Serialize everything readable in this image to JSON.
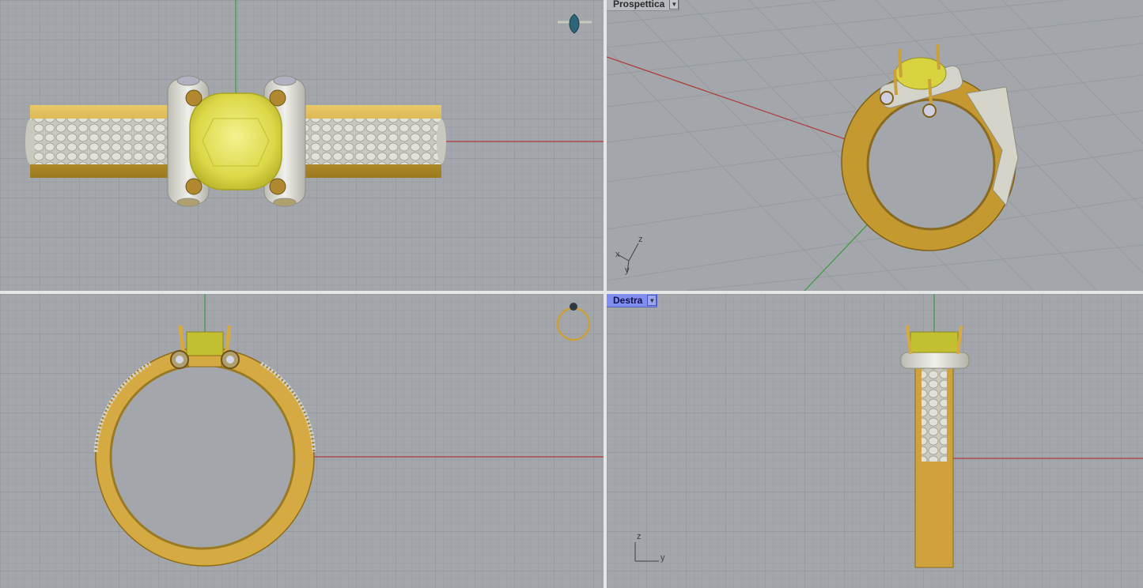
{
  "viewports": {
    "perspective": {
      "label": "Prospettica"
    },
    "right": {
      "label": "Destra"
    }
  },
  "axis_labels": {
    "x": "x",
    "y": "y",
    "z": "z"
  },
  "colors": {
    "grid_bg": "#a3a7ab",
    "grid_minor": "#989ca0",
    "grid_major": "#8c9094",
    "axis_x": "#b03a3a",
    "axis_y": "#3a9a3a",
    "gold": "#d9b048",
    "gold_dark": "#a88420",
    "silver": "#d4d3c8",
    "stone": "#e2e05a",
    "active_tab": "#7f8ef0"
  },
  "icons": [
    "dropdown-arrow-icon",
    "preview-thumbnail-icon"
  ]
}
